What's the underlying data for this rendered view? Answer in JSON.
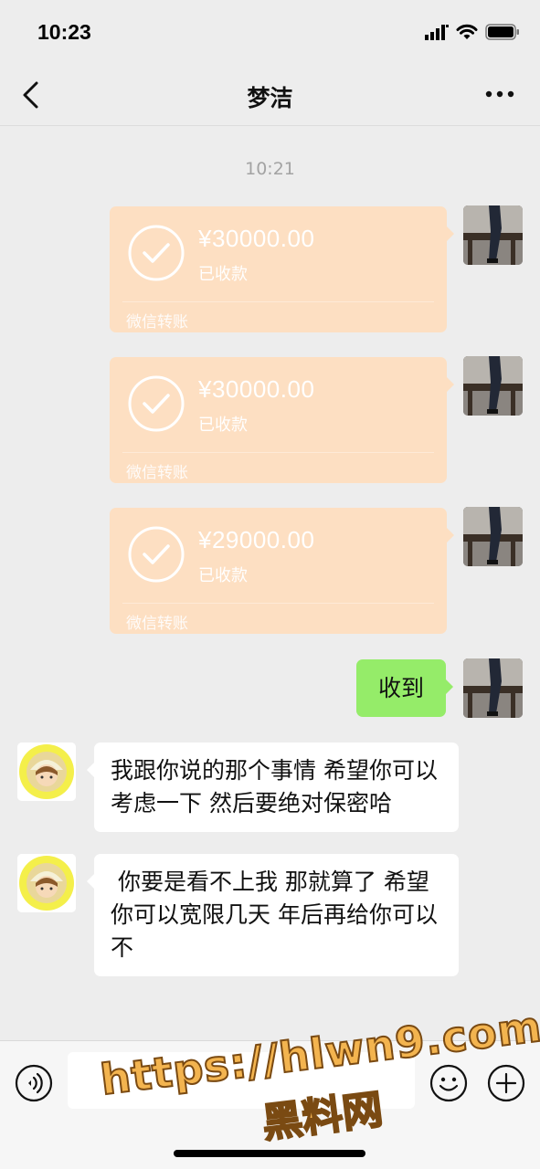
{
  "status_bar": {
    "time": "10:23",
    "icons": [
      "cellular-signal-icon",
      "wifi-icon",
      "battery-icon"
    ]
  },
  "nav": {
    "title": "梦洁",
    "back_icon": "chevron-left-icon",
    "more_icon": "more-dots-icon"
  },
  "chat": {
    "timestamp": "10:21",
    "transfers": [
      {
        "amount": "¥30000.00",
        "status": "已收款",
        "label": "微信转账"
      },
      {
        "amount": "¥30000.00",
        "status": "已收款",
        "label": "微信转账"
      },
      {
        "amount": "¥29000.00",
        "status": "已收款",
        "label": "微信转账"
      }
    ],
    "sent_text": "收到",
    "received_messages": [
      "我跟你说的那个事情 希望你可以考虑一下 然后要绝对保密哈",
      " 你要是看不上我 那就算了 希望你可以宽限几天 年后再给你可以不"
    ]
  },
  "input_bar": {
    "voice_icon": "voice-icon",
    "emoji_icon": "emoji-icon",
    "plus_icon": "plus-icon",
    "input_value": ""
  },
  "watermark": {
    "url": "https://hlwn9.com",
    "name": "黑料网"
  },
  "colors": {
    "background": "#ededed",
    "transfer_card": "#fddfc2",
    "sent_bubble": "#95ec69",
    "received_bubble": "#ffffff",
    "watermark_fill": "#f3b44f"
  }
}
